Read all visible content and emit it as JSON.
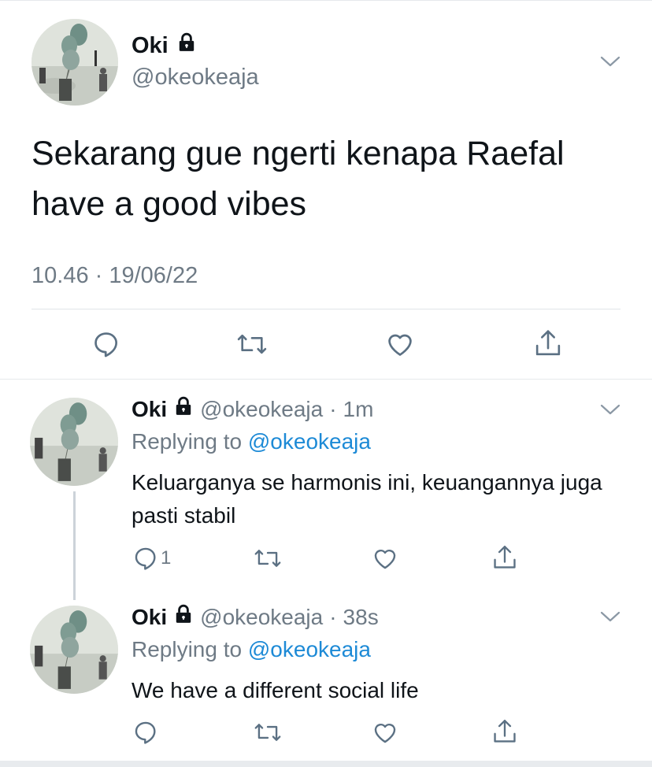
{
  "main_tweet": {
    "name": "Oki",
    "handle": "@okeokeaja",
    "text": "Sekarang gue ngerti kenapa Raefal have a good vibes",
    "timestamp": "10.46 · 19/06/22",
    "actions": [
      "reply-icon",
      "retweet-icon",
      "like-icon",
      "share-icon"
    ]
  },
  "replies": [
    {
      "name": "Oki",
      "handle": "@okeokeaja",
      "time": "1m",
      "replying_prefix": "Replying to ",
      "replying_to": "@okeokeaja",
      "text": "Keluarganya se harmonis ini, keuangannya juga pasti stabil",
      "reply_count": "1"
    },
    {
      "name": "Oki",
      "handle": "@okeokeaja",
      "time": "38s",
      "replying_prefix": "Replying to ",
      "replying_to": "@okeokeaja",
      "text": "We have a different social life",
      "reply_count": ""
    }
  ],
  "colors": {
    "text": "#0f1419",
    "secondary": "#6e7a85",
    "link": "#1d8ad6",
    "icon": "#5b7083",
    "divider": "#e1e5e8"
  }
}
